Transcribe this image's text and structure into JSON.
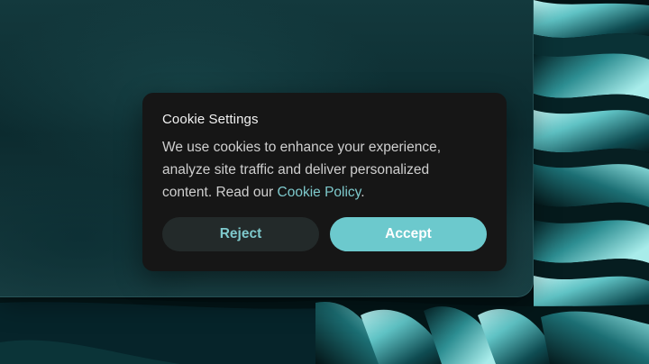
{
  "dialog": {
    "title": "Cookie Settings",
    "body_text": "We use cookies to enhance your experience, analyze site traffic and deliver personalized content. Read our ",
    "policy_link": "Cookie Policy",
    "body_end": ".",
    "reject_label": "Reject",
    "accept_label": "Accept"
  },
  "colors": {
    "accent": "#6cc9cd",
    "link": "#7ec9cc",
    "dialog_bg": "#161616",
    "reject_bg": "#232a2a"
  }
}
